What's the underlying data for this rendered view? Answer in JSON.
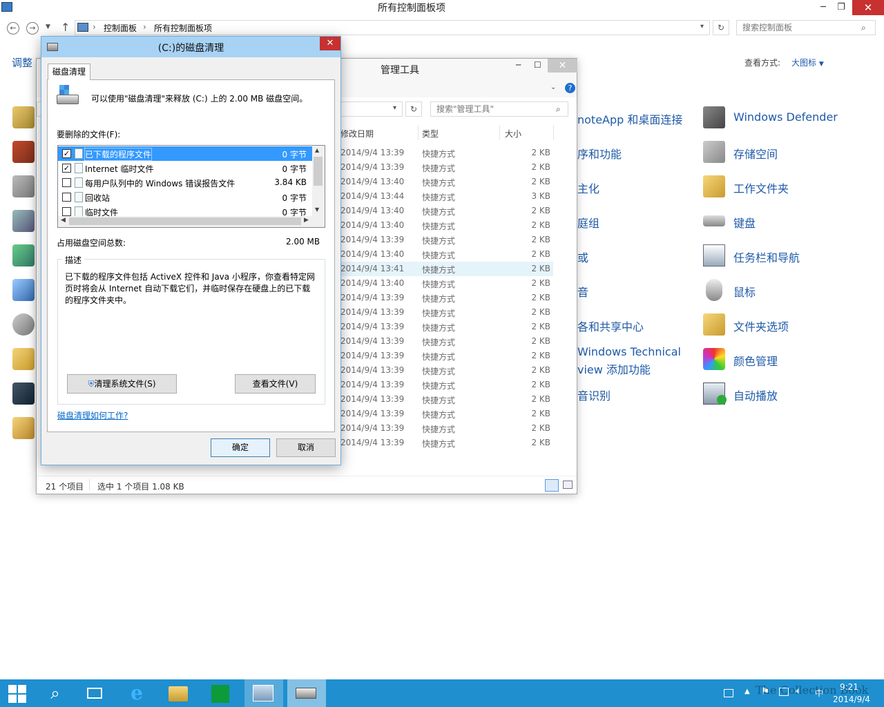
{
  "cp": {
    "title": "所有控制面板项",
    "breadcrumb": [
      "控制面板",
      "所有控制面板项"
    ],
    "search_placeholder": "搜索控制面板",
    "heading": "调整",
    "view_label": "查看方式:",
    "view_value": "大图标",
    "items": [
      {
        "label": "noteApp 和桌面连接",
        "icon": "remoteapp-icon"
      },
      {
        "label": "Windows Defender",
        "icon": "defender-icon"
      },
      {
        "label": "序和功能",
        "icon": "programs-icon"
      },
      {
        "label": "存储空间",
        "icon": "storage-icon"
      },
      {
        "label": "主化",
        "icon": "personalize-icon"
      },
      {
        "label": "工作文件夹",
        "icon": "work-folders-icon"
      },
      {
        "label": "庭组",
        "icon": "homegroup-icon"
      },
      {
        "label": "键盘",
        "icon": "keyboard-icon"
      },
      {
        "label": "或",
        "icon": "region-icon"
      },
      {
        "label": "任务栏和导航",
        "icon": "taskbar-icon"
      },
      {
        "label": "音",
        "icon": "sound-icon"
      },
      {
        "label": "鼠标",
        "icon": "mouse-icon"
      },
      {
        "label": "各和共享中心",
        "icon": "network-icon"
      },
      {
        "label": "文件夹选项",
        "icon": "folder-options-icon"
      },
      {
        "label": "Windows Technical",
        "label2": "view 添加功能",
        "icon": "addfeatures-icon"
      },
      {
        "label": "颜色管理",
        "icon": "color-icon"
      },
      {
        "label": "音识别",
        "icon": "speech-icon"
      },
      {
        "label": "自动播放",
        "icon": "autoplay-icon"
      }
    ]
  },
  "explorer": {
    "title": "管理工具",
    "search_placeholder": "搜索\"管理工具\"",
    "columns": {
      "date": "修改日期",
      "type": "类型",
      "size": "大小"
    },
    "rows": [
      {
        "date": "2014/9/4 13:39",
        "type": "快捷方式",
        "size": "2 KB"
      },
      {
        "date": "2014/9/4 13:39",
        "type": "快捷方式",
        "size": "2 KB"
      },
      {
        "date": "2014/9/4 13:40",
        "type": "快捷方式",
        "size": "2 KB"
      },
      {
        "date": "2014/9/4 13:44",
        "type": "快捷方式",
        "size": "3 KB"
      },
      {
        "date": "2014/9/4 13:40",
        "type": "快捷方式",
        "size": "2 KB"
      },
      {
        "date": "2014/9/4 13:40",
        "type": "快捷方式",
        "size": "2 KB"
      },
      {
        "date": "2014/9/4 13:39",
        "type": "快捷方式",
        "size": "2 KB"
      },
      {
        "date": "2014/9/4 13:40",
        "type": "快捷方式",
        "size": "2 KB"
      },
      {
        "date": "2014/9/4 13:41",
        "type": "快捷方式",
        "size": "2 KB"
      },
      {
        "date": "2014/9/4 13:40",
        "type": "快捷方式",
        "size": "2 KB"
      },
      {
        "date": "2014/9/4 13:39",
        "type": "快捷方式",
        "size": "2 KB"
      },
      {
        "date": "2014/9/4 13:39",
        "type": "快捷方式",
        "size": "2 KB"
      },
      {
        "date": "2014/9/4 13:39",
        "type": "快捷方式",
        "size": "2 KB"
      },
      {
        "date": "2014/9/4 13:39",
        "type": "快捷方式",
        "size": "2 KB"
      },
      {
        "date": "2014/9/4 13:39",
        "type": "快捷方式",
        "size": "2 KB"
      },
      {
        "date": "2014/9/4 13:39",
        "type": "快捷方式",
        "size": "2 KB"
      },
      {
        "date": "2014/9/4 13:39",
        "type": "快捷方式",
        "size": "2 KB"
      },
      {
        "date": "2014/9/4 13:39",
        "type": "快捷方式",
        "size": "2 KB"
      },
      {
        "date": "2014/9/4 13:39",
        "type": "快捷方式",
        "size": "2 KB"
      },
      {
        "date": "2014/9/4 13:39",
        "type": "快捷方式",
        "size": "2 KB"
      },
      {
        "date": "2014/9/4 13:39",
        "type": "快捷方式",
        "size": "2 KB"
      }
    ],
    "status_count": "21 个项目",
    "status_selected": "选中 1 个项目  1.08 KB"
  },
  "dialog": {
    "title": "(C:)的磁盘清理",
    "tab": "磁盘清理",
    "intro": "可以使用\"磁盘清理\"来释放  (C:) 上的 2.00 MB 磁盘空间。",
    "files_label": "要删除的文件(F):",
    "files": [
      {
        "name": "已下载的程序文件",
        "size": "0 字节",
        "checked": true,
        "selected": true
      },
      {
        "name": "Internet 临时文件",
        "size": "0 字节",
        "checked": true,
        "selected": false
      },
      {
        "name": "每用户队列中的 Windows 错误报告文件",
        "size": "3.84 KB",
        "checked": false,
        "selected": false
      },
      {
        "name": "回收站",
        "size": "0 字节",
        "checked": false,
        "selected": false
      },
      {
        "name": "临时文件",
        "size": "0 字节",
        "checked": false,
        "selected": false
      }
    ],
    "total_label": "占用磁盘空间总数:",
    "total_value": "2.00 MB",
    "group_label": "描述",
    "description": "已下载的程序文件包括 ActiveX 控件和 Java 小程序，你查看特定网页时将会从 Internet 自动下载它们，并临时保存在硬盘上的已下载的程序文件夹中。",
    "clean_system_btn": "清理系统文件(S)",
    "view_files_btn": "查看文件(V)",
    "help_link": "磁盘清理如何工作?",
    "ok_btn": "确定",
    "cancel_btn": "取消"
  },
  "taskbar": {
    "time": "9:21",
    "date": "2014/9/4",
    "ime": "中",
    "watermark": "The Collection Book"
  }
}
